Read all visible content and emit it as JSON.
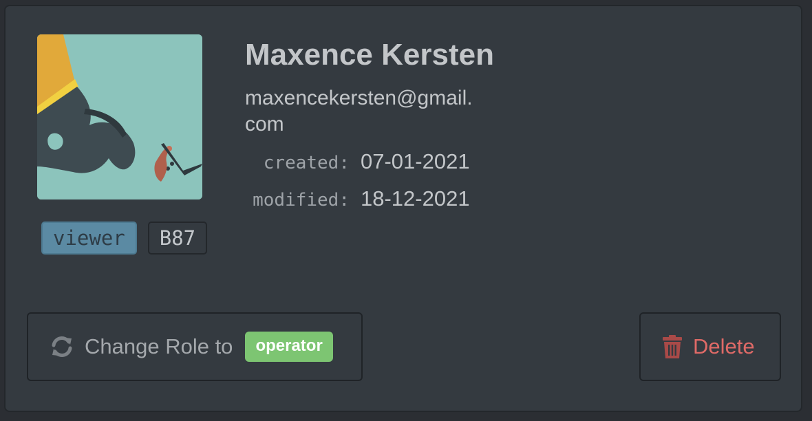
{
  "user": {
    "name": "Maxence Kersten",
    "email": "maxencekersten@gmail.com",
    "avatar_icon": "hand-holding-beads-icon",
    "role": "viewer",
    "code": "B87",
    "created_label": "created:",
    "created": "07-01-2021",
    "modified_label": "modified:",
    "modified": "18-12-2021"
  },
  "actions": {
    "change_role_label": "Change Role to",
    "change_role_icon": "refresh-icon",
    "target_role": "operator",
    "delete_label": "Delete",
    "delete_icon": "trash-icon"
  },
  "colors": {
    "card_bg": "#343a40",
    "role_tag": "#5b8aa3",
    "operator_badge": "#7dc572",
    "delete_text": "#df6a67"
  }
}
